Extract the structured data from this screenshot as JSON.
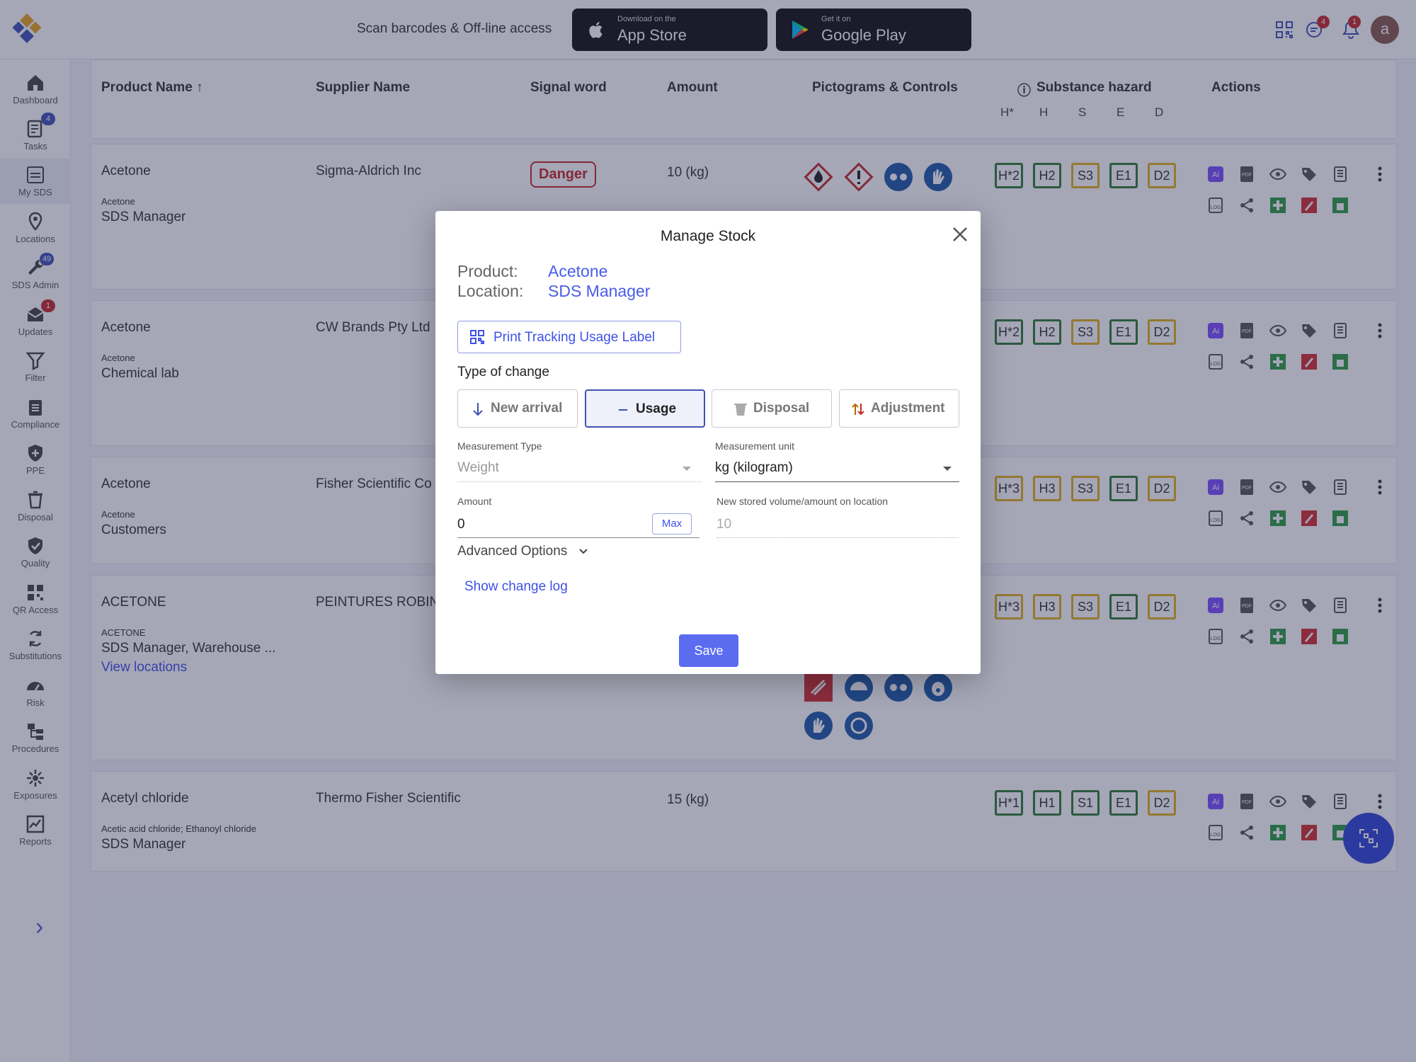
{
  "topbar": {
    "scan_text": "Scan barcodes & Off-line access",
    "app_store": {
      "small": "Download on the",
      "big": "App Store"
    },
    "google_play": {
      "small": "Get it on",
      "big": "Google Play"
    },
    "badge_messages": "4",
    "badge_notifications": "1",
    "avatar_letter": "a"
  },
  "sidebar": {
    "items": [
      {
        "label": "Dashboard",
        "icon": "home-icon"
      },
      {
        "label": "Tasks",
        "icon": "tasks-icon",
        "badge": "4"
      },
      {
        "label": "My SDS",
        "icon": "sds-icon",
        "active": true
      },
      {
        "label": "Locations",
        "icon": "location-icon"
      },
      {
        "label": "SDS Admin",
        "icon": "wrench-icon",
        "badge": "49"
      },
      {
        "label": "Updates",
        "icon": "mail-icon",
        "badge": "1"
      },
      {
        "label": "Filter",
        "icon": "filter-icon"
      },
      {
        "label": "Compliance",
        "icon": "clipboard-icon"
      },
      {
        "label": "PPE",
        "icon": "shield-plus-icon"
      },
      {
        "label": "Disposal",
        "icon": "trash-icon"
      },
      {
        "label": "Quality",
        "icon": "shield-check-icon"
      },
      {
        "label": "QR Access",
        "icon": "qr-icon"
      },
      {
        "label": "Substitutions",
        "icon": "sync-icon"
      },
      {
        "label": "Risk",
        "icon": "gauge-icon"
      },
      {
        "label": "Procedures",
        "icon": "procedures-icon"
      },
      {
        "label": "Exposures",
        "icon": "exposure-icon"
      },
      {
        "label": "Reports",
        "icon": "reports-icon"
      }
    ],
    "expand": "›"
  },
  "table": {
    "headers": {
      "product": "Product Name",
      "supplier": "Supplier Name",
      "signal": "Signal word",
      "amount": "Amount",
      "pictograms": "Pictograms & Controls",
      "hazard": "Substance hazard",
      "actions": "Actions",
      "hazard_sub": [
        "H*",
        "H",
        "S",
        "E",
        "D"
      ]
    },
    "rows": [
      {
        "product": "Acetone",
        "subname": "Acetone",
        "location": "SDS Manager",
        "supplier": "Sigma-Aldrich Inc",
        "signal": "Danger",
        "amount": "10 (kg)",
        "hazards": [
          "H*2",
          "H2",
          "S3",
          "E1",
          "D2"
        ]
      },
      {
        "product": "Acetone",
        "subname": "Acetone",
        "location": "Chemical lab",
        "supplier": "CW Brands Pty Ltd",
        "hazards": [
          "H*2",
          "H2",
          "S3",
          "E1",
          "D2"
        ]
      },
      {
        "product": "Acetone",
        "subname": "Acetone",
        "location": "Customers",
        "supplier": "Fisher Scientific Co",
        "hazards": [
          "H*3",
          "H3",
          "S3",
          "E1",
          "D2"
        ]
      },
      {
        "product": "ACETONE",
        "subname": "ACETONE",
        "location": "SDS Manager, Warehouse ...",
        "link": "View locations",
        "supplier": "PEINTURES ROBIN",
        "hazards": [
          "H*3",
          "H3",
          "S3",
          "E1",
          "D2"
        ]
      },
      {
        "product": "Acetyl chloride",
        "subname": "Acetic acid chloride; Ethanoyl chloride",
        "location": "SDS Manager",
        "supplier": "Thermo Fisher Scientific",
        "amount": "15 (kg)",
        "hazards": [
          "H*1",
          "H1",
          "S1",
          "E1",
          "D2"
        ]
      }
    ]
  },
  "modal": {
    "title": "Manage Stock",
    "product_label": "Product:",
    "product_value": "Acetone",
    "location_label": "Location:",
    "location_value": "SDS Manager",
    "print_label": "Print Tracking Usage Label",
    "type_label": "Type of change",
    "types": [
      "New arrival",
      "Usage",
      "Disposal",
      "Adjustment"
    ],
    "selected_type": "Usage",
    "measurement_type_label": "Measurement Type",
    "measurement_type_value": "Weight",
    "measurement_unit_label": "Measurement unit",
    "measurement_unit_value": "kg (kilogram)",
    "amount_label": "Amount",
    "amount_value": "0",
    "max_label": "Max",
    "new_stored_label": "New stored volume/amount on location",
    "new_stored_value": "10",
    "advanced_label": "Advanced Options",
    "changelog_label": "Show change log",
    "save_label": "Save"
  },
  "colors": {
    "accent": "#3f51e8",
    "danger": "#c62828",
    "green": "#2e7d32",
    "yellow": "#e0b11b"
  }
}
